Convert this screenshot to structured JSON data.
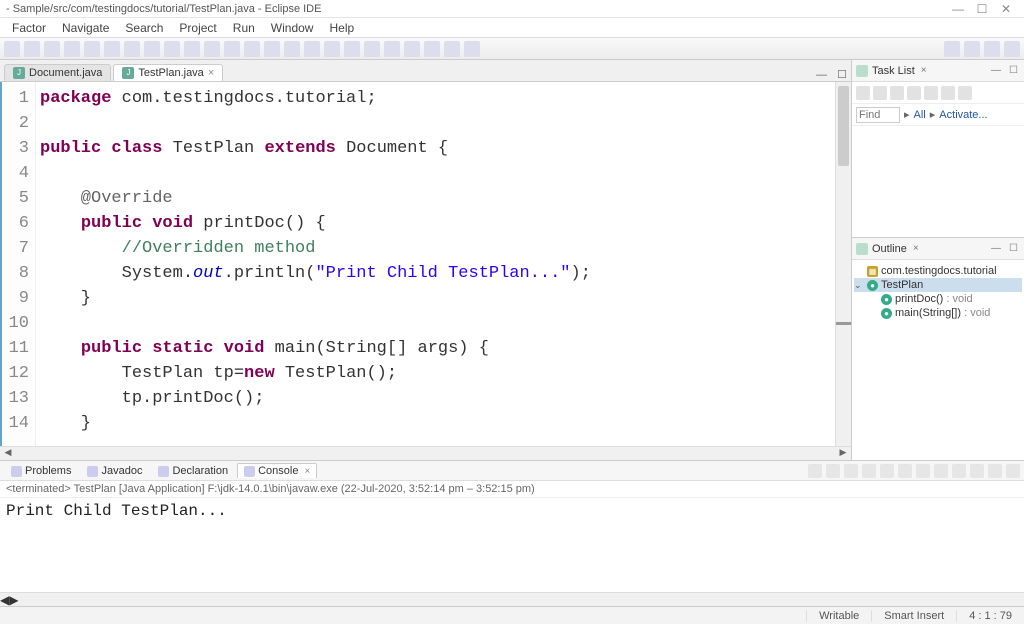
{
  "window": {
    "title": "- Sample/src/com/testingdocs/tutorial/TestPlan.java - Eclipse IDE"
  },
  "menu": [
    "Factor",
    "Navigate",
    "Search",
    "Project",
    "Run",
    "Window",
    "Help"
  ],
  "editor_tabs": [
    {
      "label": "Document.java",
      "active": false
    },
    {
      "label": "TestPlan.java",
      "active": true
    }
  ],
  "code": {
    "lines": [
      {
        "n": "1",
        "tokens": [
          {
            "t": "package",
            "c": "kw"
          },
          {
            "t": " com.testingdocs.tutorial;",
            "c": ""
          }
        ]
      },
      {
        "n": "2",
        "tokens": []
      },
      {
        "n": "3",
        "tokens": [
          {
            "t": "public",
            "c": "kw"
          },
          {
            "t": " class",
            "c": "kw"
          },
          {
            "t": " TestPlan ",
            "c": ""
          },
          {
            "t": "extends",
            "c": "kw"
          },
          {
            "t": " Document {",
            "c": ""
          }
        ]
      },
      {
        "n": "4",
        "tokens": [],
        "highlight": true
      },
      {
        "n": "5",
        "tokens": [
          {
            "t": "    @Override",
            "c": "ann"
          }
        ]
      },
      {
        "n": "6",
        "tokens": [
          {
            "t": "    ",
            "c": ""
          },
          {
            "t": "public",
            "c": "kw"
          },
          {
            "t": " void",
            "c": "kw"
          },
          {
            "t": " printDoc() {",
            "c": ""
          }
        ]
      },
      {
        "n": "7",
        "tokens": [
          {
            "t": "        ",
            "c": ""
          },
          {
            "t": "//Overridden method",
            "c": "com"
          }
        ]
      },
      {
        "n": "8",
        "tokens": [
          {
            "t": "        System.",
            "c": ""
          },
          {
            "t": "out",
            "c": "fld"
          },
          {
            "t": ".println(",
            "c": ""
          },
          {
            "t": "\"Print Child TestPlan...\"",
            "c": "str"
          },
          {
            "t": ");",
            "c": ""
          }
        ]
      },
      {
        "n": "9",
        "tokens": [
          {
            "t": "    }",
            "c": ""
          }
        ]
      },
      {
        "n": "10",
        "tokens": []
      },
      {
        "n": "11",
        "tokens": [
          {
            "t": "    ",
            "c": ""
          },
          {
            "t": "public",
            "c": "kw"
          },
          {
            "t": " static",
            "c": "kw"
          },
          {
            "t": " void",
            "c": "kw"
          },
          {
            "t": " main(String[] args) {",
            "c": ""
          }
        ]
      },
      {
        "n": "12",
        "tokens": [
          {
            "t": "        TestPlan tp=",
            "c": ""
          },
          {
            "t": "new",
            "c": "kw"
          },
          {
            "t": " TestPlan();",
            "c": ""
          }
        ]
      },
      {
        "n": "13",
        "tokens": [
          {
            "t": "        tp.printDoc();",
            "c": ""
          }
        ]
      },
      {
        "n": "14",
        "tokens": [
          {
            "t": "    }",
            "c": ""
          }
        ]
      }
    ]
  },
  "task_view": {
    "title": "Task List",
    "find_placeholder": "Find",
    "all_label": "All",
    "activate_label": "Activate..."
  },
  "outline_view": {
    "title": "Outline",
    "rows": [
      {
        "indent": 0,
        "toggle": "",
        "iconcls": "pkg",
        "label": "com.testingdocs.tutorial",
        "ret": ""
      },
      {
        "indent": 0,
        "toggle": "⌄",
        "iconcls": "cls",
        "label": "TestPlan",
        "ret": "",
        "sel": true
      },
      {
        "indent": 1,
        "toggle": "",
        "iconcls": "mth",
        "label": "printDoc()",
        "ret": " : void"
      },
      {
        "indent": 1,
        "toggle": "",
        "iconcls": "mth",
        "label": "main(String[])",
        "ret": " : void"
      }
    ]
  },
  "bottom_tabs": [
    {
      "label": "Problems",
      "active": false
    },
    {
      "label": "Javadoc",
      "active": false
    },
    {
      "label": "Declaration",
      "active": false
    },
    {
      "label": "Console",
      "active": true
    }
  ],
  "console": {
    "info": "<terminated> TestPlan [Java Application] F:\\jdk-14.0.1\\bin\\javaw.exe  (22-Jul-2020, 3:52:14 pm – 3:52:15 pm)",
    "output": "Print Child TestPlan..."
  },
  "status": {
    "writable": "Writable",
    "insert": "Smart Insert",
    "pos": "4 : 1 : 79"
  }
}
